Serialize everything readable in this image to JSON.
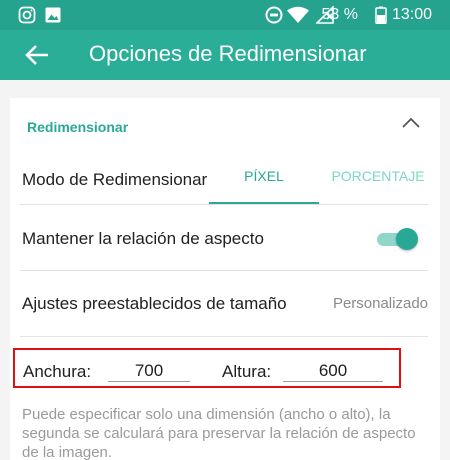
{
  "status_bar": {
    "battery": "53 %",
    "time": "13:00"
  },
  "app_bar": {
    "title": "Opciones de Redimensionar"
  },
  "resize": {
    "section_title": "Redimensionar",
    "mode_label": "Modo de Redimensionar",
    "tabs": [
      "PÍXEL",
      "PORCENTAJE"
    ],
    "active_tab": "PÍXEL",
    "aspect_label": "Mantener la relación de aspecto",
    "aspect_enabled": true,
    "presets_label": "Ajustes preestablecidos de tamaño",
    "presets_value": "Personalizado",
    "width_label": "Anchura:",
    "width_value": "700",
    "height_label": "Altura:",
    "height_value": "600",
    "hint": "Puede especificar solo una dimensión (ancho o alto), la segunda se calculará para preservar la relación de aspecto de la imagen."
  },
  "colors": {
    "accent": "#2aa896",
    "app_bar": "#2aae98",
    "status_bar": "#25a38f",
    "highlight_box": "#e01010"
  },
  "icons": [
    "instagram-icon",
    "image-icon",
    "data-saver-icon",
    "wifi-icon",
    "signal-icon",
    "battery-icon",
    "back-arrow-icon",
    "chevron-up-icon"
  ]
}
